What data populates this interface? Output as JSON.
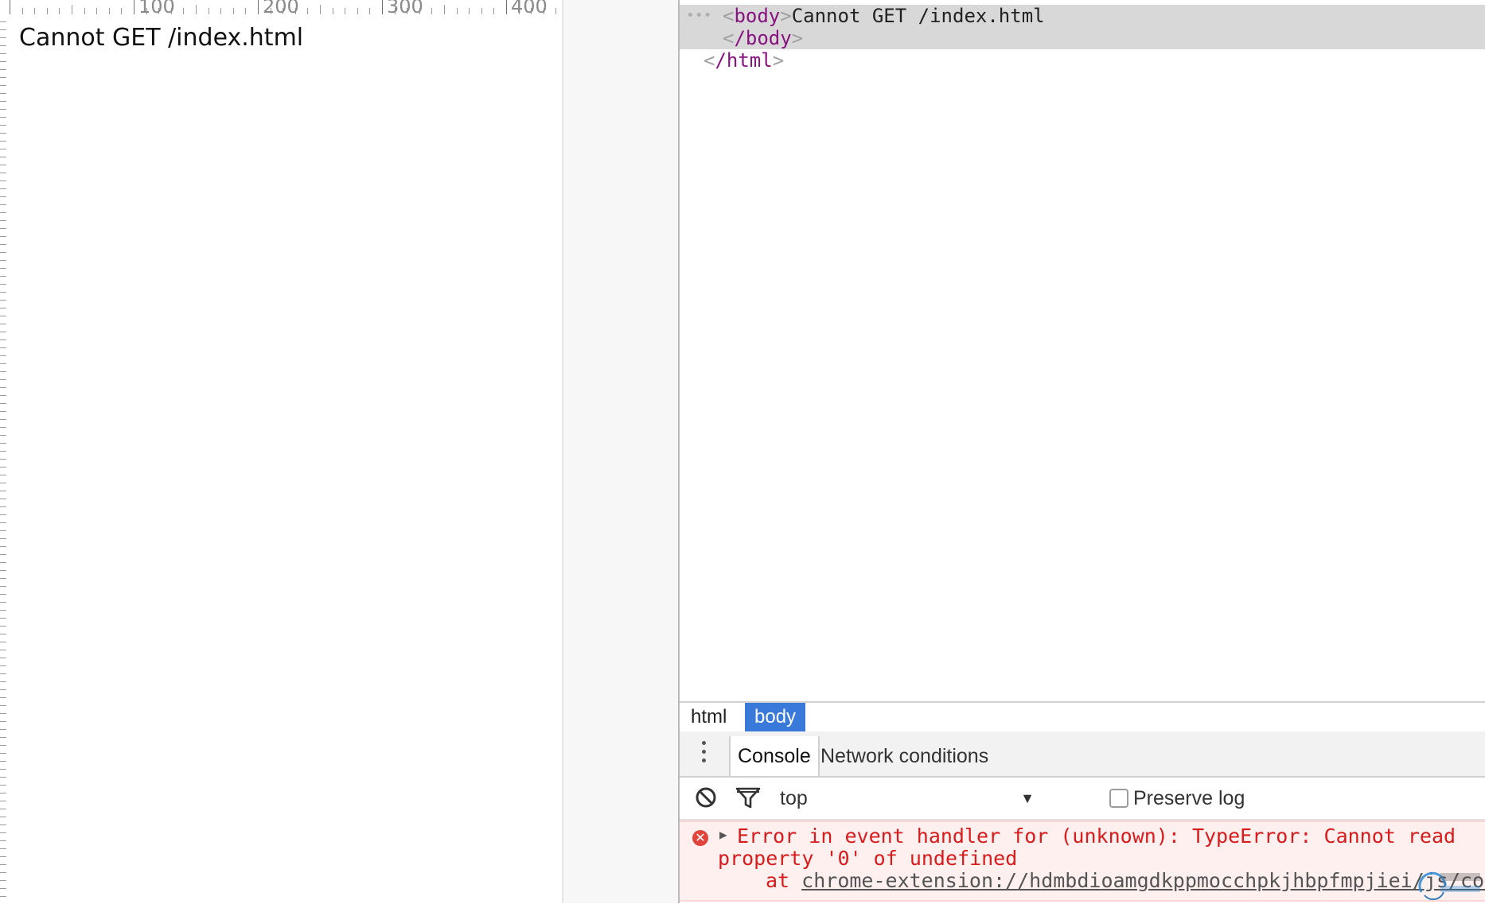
{
  "viewport": {
    "ruler_labels": [
      "100",
      "200",
      "300",
      "400"
    ],
    "page_text": "Cannot GET /index.html"
  },
  "devtools": {
    "dom_tree": {
      "line1": {
        "open_tag": "body",
        "text": "Cannot GET /index.html"
      },
      "line2": {
        "close_tag": "/body"
      },
      "line3": {
        "close_tag": "/html"
      }
    },
    "breadcrumb": [
      "html",
      "body"
    ],
    "drawer_tabs": [
      "Console",
      "Network conditions"
    ],
    "console_toolbar": {
      "context": "top",
      "preserve_log_label": "Preserve log",
      "preserve_log_checked": false
    },
    "console_error": {
      "line1": "Error in event handler for (unknown): TypeError: Cannot read",
      "line2": "property '0' of undefined",
      "line3_prefix": "at",
      "line3_link": "chrome-extension://hdmbdioamgdkppmocchpkjhbpfmpjiei/js/conte"
    }
  },
  "colors": {
    "tag": "#881280",
    "error_text": "#d81b1b",
    "error_bg": "#fff0f0",
    "selected_crumb": "#3879d9"
  },
  "icons": {
    "clear": "clear-console-icon",
    "filter": "filter-icon",
    "error": "error-icon",
    "menu": "vertical-ellipsis-icon"
  }
}
